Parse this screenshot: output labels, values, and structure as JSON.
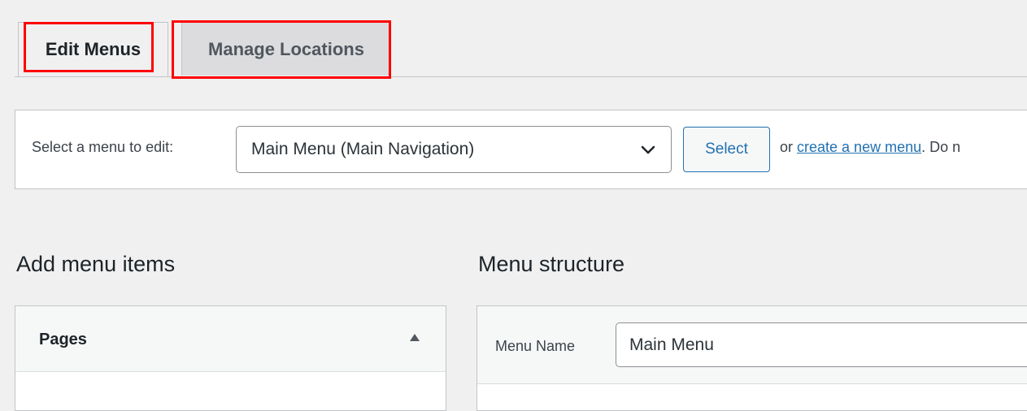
{
  "tabs": [
    {
      "label": "Edit Menus",
      "active": true
    },
    {
      "label": "Manage Locations",
      "active": false
    }
  ],
  "manage": {
    "select_label": "Select a menu to edit:",
    "selected_menu": "Main Menu (Main Navigation)",
    "select_button": "Select",
    "or_text": "or ",
    "create_link": "create a new menu",
    "trailing_text": ". Do n"
  },
  "left_column": {
    "heading": "Add menu items",
    "accordion_title": "Pages"
  },
  "right_column": {
    "heading": "Menu structure",
    "menu_name_label": "Menu Name",
    "menu_name_value": "Main Menu"
  },
  "colors": {
    "highlight": "#ff0000",
    "accent": "#2271b1",
    "background": "#f0f0f1"
  },
  "icons": {
    "select_chevron": "chevron-down-icon",
    "accordion_toggle": "arrow-up-icon"
  }
}
